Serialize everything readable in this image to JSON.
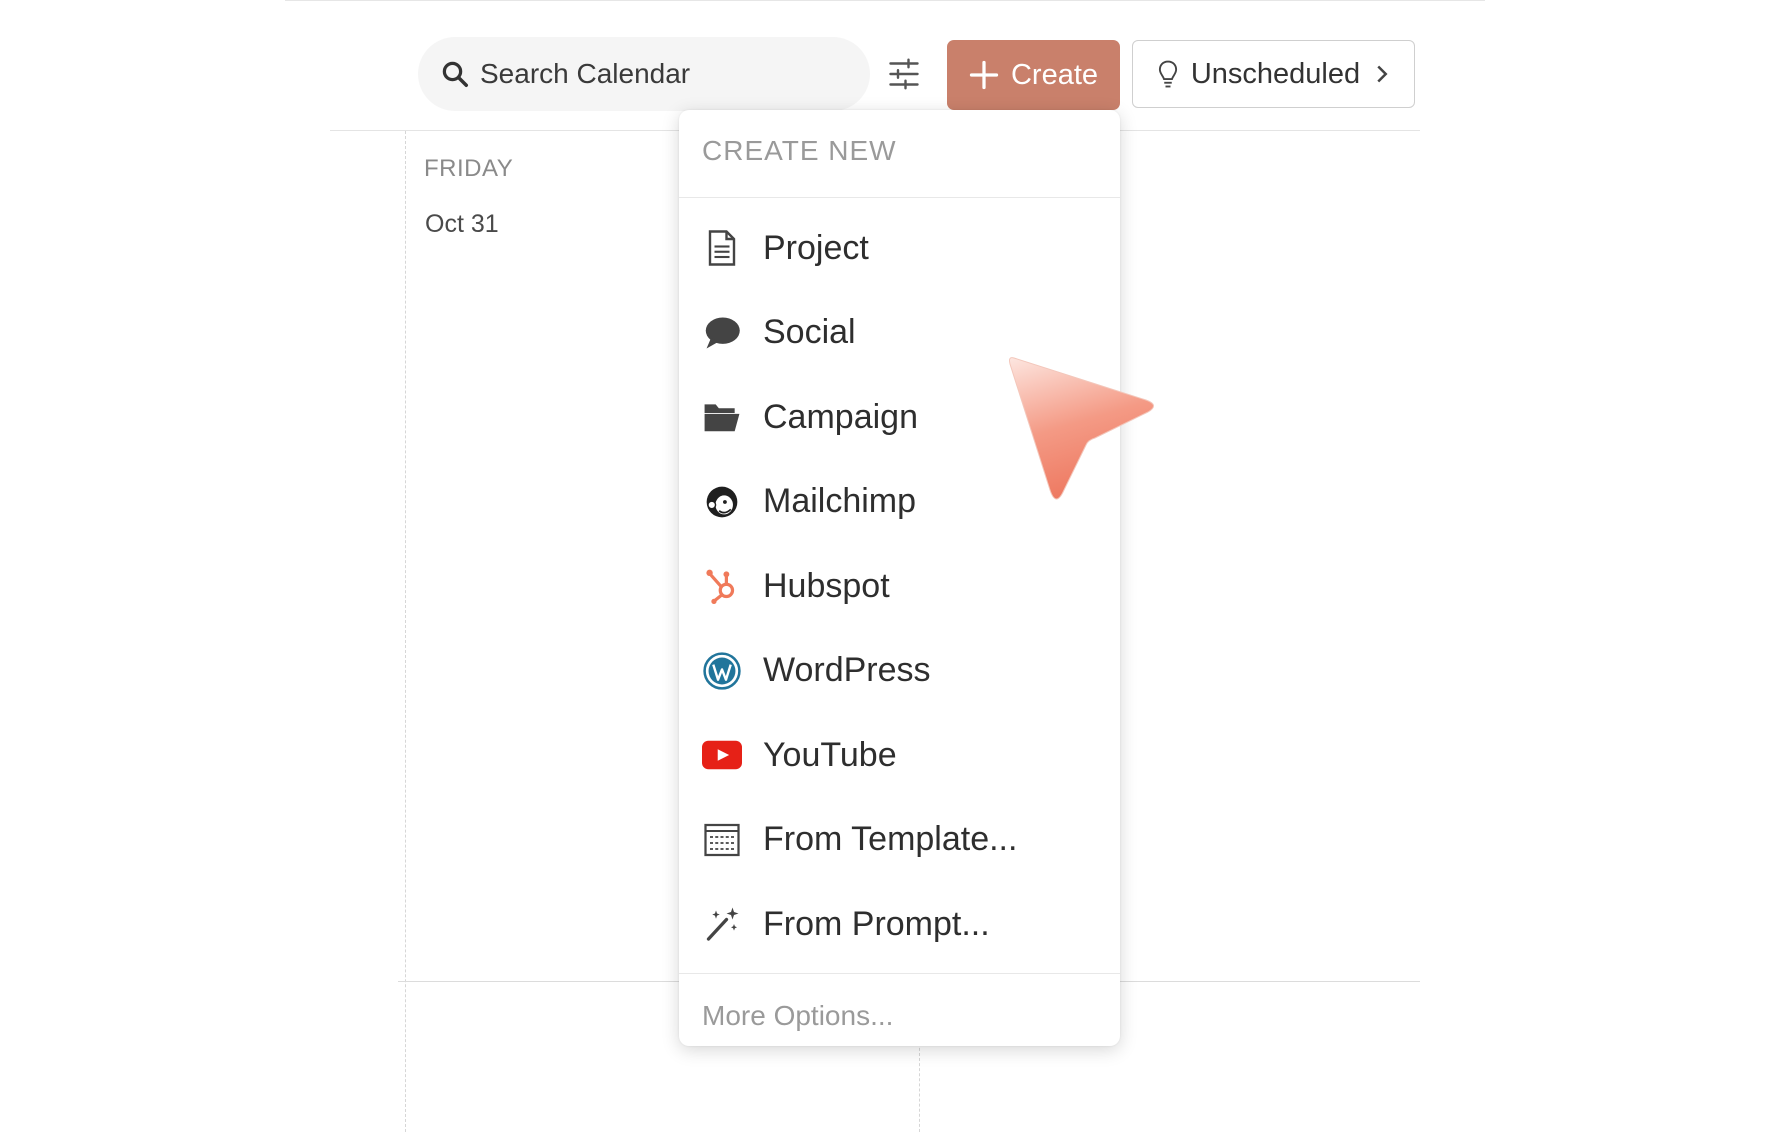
{
  "search": {
    "placeholder": "Search Calendar"
  },
  "toolbar": {
    "create_label": "Create",
    "unscheduled_label": "Unscheduled"
  },
  "calendar": {
    "day_name": "FRIDAY",
    "day_date": "Oct 31"
  },
  "create_menu": {
    "header": "CREATE NEW",
    "items": [
      {
        "label": "Project",
        "icon": "document-icon"
      },
      {
        "label": "Social",
        "icon": "speech-bubble-icon"
      },
      {
        "label": "Campaign",
        "icon": "folder-open-icon"
      },
      {
        "label": "Mailchimp",
        "icon": "mailchimp-icon"
      },
      {
        "label": "Hubspot",
        "icon": "hubspot-icon"
      },
      {
        "label": "WordPress",
        "icon": "wordpress-icon"
      },
      {
        "label": "YouTube",
        "icon": "youtube-icon"
      },
      {
        "label": "From Template...",
        "icon": "template-icon"
      },
      {
        "label": "From Prompt...",
        "icon": "magic-wand-icon"
      }
    ],
    "more_options": "More Options..."
  },
  "colors": {
    "create_button": "#c9806b",
    "hubspot": "#f07a5a",
    "youtube": "#e62117",
    "wordpress": "#21759b",
    "pointer": "#f08a74"
  }
}
